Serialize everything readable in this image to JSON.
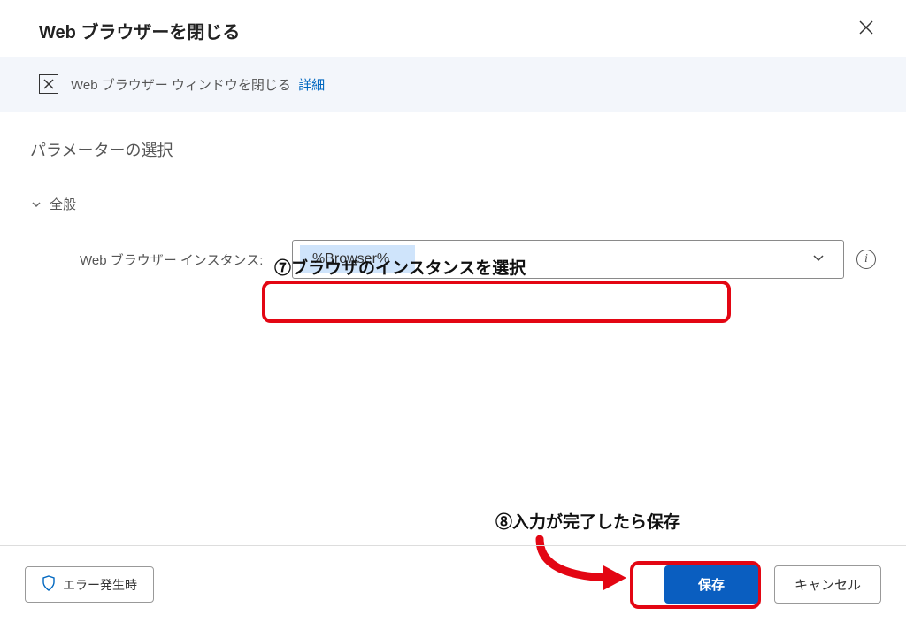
{
  "header": {
    "title": "Web ブラウザーを閉じる"
  },
  "banner": {
    "icon_name": "close-box-icon",
    "text": "Web ブラウザー ウィンドウを閉じる",
    "link": "詳細"
  },
  "section": {
    "title": "パラメーターの選択"
  },
  "group": {
    "label": "全般"
  },
  "field": {
    "label": "Web ブラウザー インスタンス:",
    "value": "%Browser%"
  },
  "annotations": {
    "step7": "⑦ブラウザのインスタンスを選択",
    "step8": "⑧入力が完了したら保存"
  },
  "footer": {
    "error_button": "エラー発生時",
    "save": "保存",
    "cancel": "キャンセル"
  }
}
